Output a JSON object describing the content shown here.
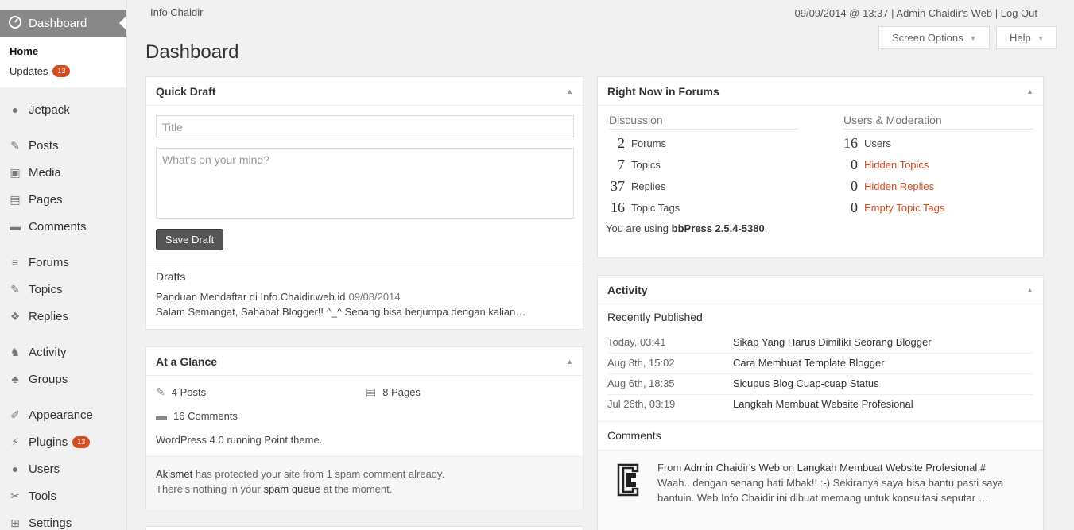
{
  "sidebar": {
    "active": {
      "label": "Dashboard",
      "icon": "dashboard-icon"
    },
    "sub": [
      {
        "label": "Home"
      },
      {
        "label": "Updates",
        "count": "13"
      }
    ],
    "groups": [
      [
        {
          "label": "Jetpack",
          "icon": "jetpack-icon"
        }
      ],
      [
        {
          "label": "Posts",
          "icon": "pin-icon"
        },
        {
          "label": "Media",
          "icon": "media-icon"
        },
        {
          "label": "Pages",
          "icon": "pages-icon"
        },
        {
          "label": "Comments",
          "icon": "comment-icon"
        }
      ],
      [
        {
          "label": "Forums",
          "icon": "forums-icon"
        },
        {
          "label": "Topics",
          "icon": "topics-icon"
        },
        {
          "label": "Replies",
          "icon": "replies-icon"
        }
      ],
      [
        {
          "label": "Activity",
          "icon": "activity-icon"
        },
        {
          "label": "Groups",
          "icon": "groups-icon"
        }
      ],
      [
        {
          "label": "Appearance",
          "icon": "brush-icon"
        },
        {
          "label": "Plugins",
          "icon": "plugin-icon",
          "count": "13"
        },
        {
          "label": "Users",
          "icon": "user-icon"
        },
        {
          "label": "Tools",
          "icon": "wrench-icon"
        },
        {
          "label": "Settings",
          "icon": "settings-icon"
        }
      ]
    ]
  },
  "topbar": {
    "site_name": "Info Chaidir",
    "user_meta": "09/09/2014 @ 13:37 | Admin Chaidir's Web | Log Out",
    "screen_options": "Screen Options",
    "help": "Help"
  },
  "page_title": "Dashboard",
  "quick_draft": {
    "title": "Quick Draft",
    "title_placeholder": "Title",
    "content_placeholder": "What's on your mind?",
    "save_label": "Save Draft",
    "drafts_title": "Drafts",
    "draft_link": "Panduan Mendaftar di Info.Chaidir.web.id",
    "draft_date": "09/08/2014",
    "draft_excerpt": "Salam Semangat, Sahabat Blogger!! ^_^ Senang bisa berjumpa dengan kalian…"
  },
  "at_a_glance": {
    "title": "At a Glance",
    "posts": "4 Posts",
    "pages": "8 Pages",
    "comments": "16 Comments",
    "wp_version": "WordPress 4.0 running Point theme.",
    "akismet_link": "Akismet",
    "akismet_text": " has protected your site from 1 spam comment already.",
    "spam_prefix": "There's nothing in your ",
    "spam_link": "spam queue",
    "spam_suffix": " at the moment."
  },
  "right_now": {
    "title": "Right Now in Forums",
    "discussion_title": "Discussion",
    "moderation_title": "Users & Moderation",
    "discussion": [
      {
        "num": "2",
        "label": "Forums"
      },
      {
        "num": "7",
        "label": "Topics"
      },
      {
        "num": "37",
        "label": "Replies"
      },
      {
        "num": "16",
        "label": "Topic Tags"
      }
    ],
    "moderation": [
      {
        "num": "16",
        "label": "Users"
      },
      {
        "num": "0",
        "label": "Hidden Topics"
      },
      {
        "num": "0",
        "label": "Hidden Replies"
      },
      {
        "num": "0",
        "label": "Empty Topic Tags"
      }
    ],
    "using_prefix": "You are using ",
    "using_version": "bbPress 2.5.4-5380",
    "using_suffix": "."
  },
  "activity": {
    "title": "Activity",
    "recent_title": "Recently Published",
    "items": [
      {
        "date": "Today, 03:41",
        "title": "Sikap Yang Harus Dimiliki Seorang Blogger"
      },
      {
        "date": "Aug 8th, 15:02",
        "title": "Cara Membuat Template Blogger"
      },
      {
        "date": "Aug 6th, 18:35",
        "title": "Sicupus Blog Cuap-cuap Status"
      },
      {
        "date": "Jul 26th, 03:19",
        "title": "Langkah Membuat Website Profesional"
      }
    ],
    "comments_title": "Comments",
    "comment_from": "From ",
    "comment_author": "Admin Chaidir's Web",
    "comment_on": " on ",
    "comment_post": "Langkah Membuat Website Profesional #",
    "comment_body": "Waah.. dengan senang hati Mbak!! :-) Sekiranya saya bisa bantu pasti saya bantuin. Web Info Chaidir ini dibuat memang untuk konsultasi seputar …"
  }
}
